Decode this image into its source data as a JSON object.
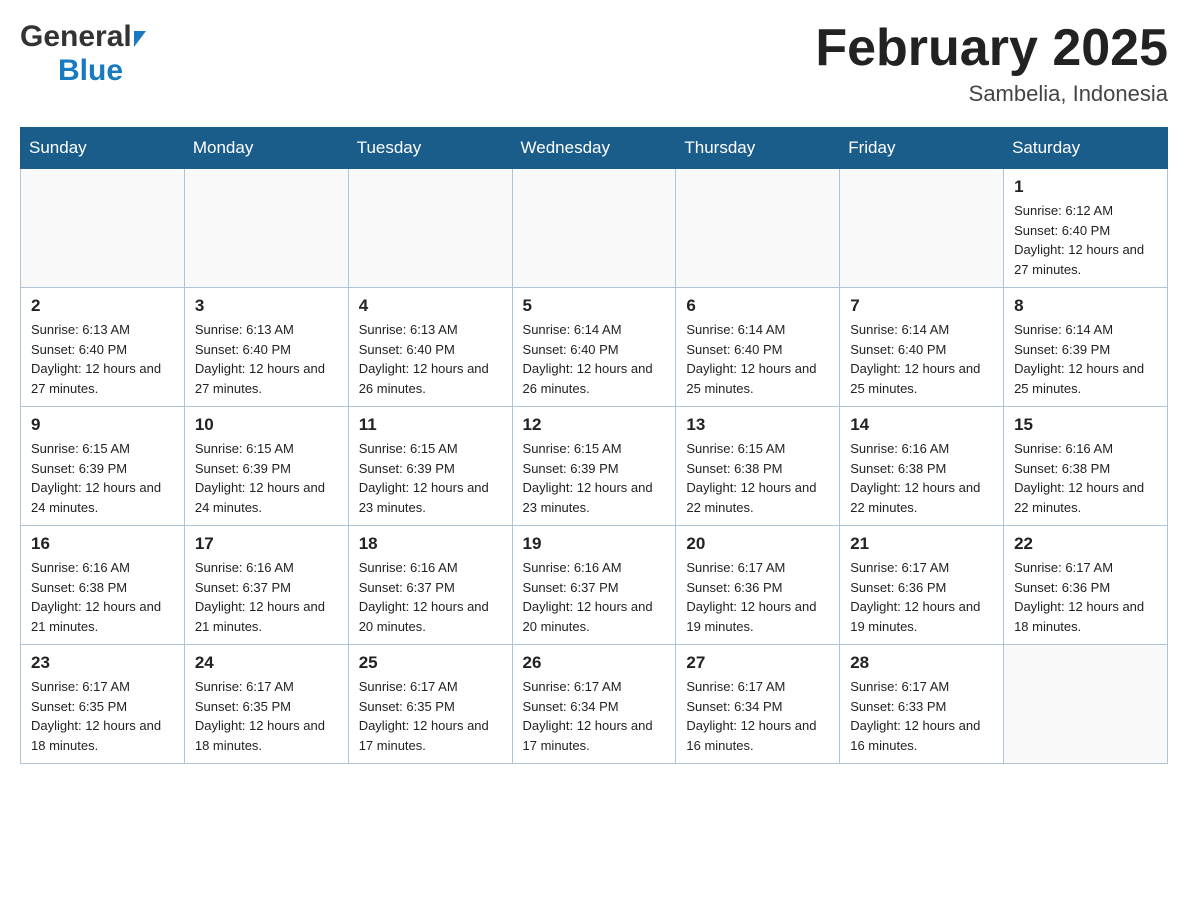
{
  "header": {
    "logo_general": "General",
    "logo_blue": "Blue",
    "month_title": "February 2025",
    "location": "Sambelia, Indonesia"
  },
  "days_of_week": [
    "Sunday",
    "Monday",
    "Tuesday",
    "Wednesday",
    "Thursday",
    "Friday",
    "Saturday"
  ],
  "weeks": [
    {
      "days": [
        {
          "number": "",
          "sunrise": "",
          "sunset": "",
          "daylight": "",
          "empty": true
        },
        {
          "number": "",
          "sunrise": "",
          "sunset": "",
          "daylight": "",
          "empty": true
        },
        {
          "number": "",
          "sunrise": "",
          "sunset": "",
          "daylight": "",
          "empty": true
        },
        {
          "number": "",
          "sunrise": "",
          "sunset": "",
          "daylight": "",
          "empty": true
        },
        {
          "number": "",
          "sunrise": "",
          "sunset": "",
          "daylight": "",
          "empty": true
        },
        {
          "number": "",
          "sunrise": "",
          "sunset": "",
          "daylight": "",
          "empty": true
        },
        {
          "number": "1",
          "sunrise": "Sunrise: 6:12 AM",
          "sunset": "Sunset: 6:40 PM",
          "daylight": "Daylight: 12 hours and 27 minutes.",
          "empty": false
        }
      ]
    },
    {
      "days": [
        {
          "number": "2",
          "sunrise": "Sunrise: 6:13 AM",
          "sunset": "Sunset: 6:40 PM",
          "daylight": "Daylight: 12 hours and 27 minutes.",
          "empty": false
        },
        {
          "number": "3",
          "sunrise": "Sunrise: 6:13 AM",
          "sunset": "Sunset: 6:40 PM",
          "daylight": "Daylight: 12 hours and 27 minutes.",
          "empty": false
        },
        {
          "number": "4",
          "sunrise": "Sunrise: 6:13 AM",
          "sunset": "Sunset: 6:40 PM",
          "daylight": "Daylight: 12 hours and 26 minutes.",
          "empty": false
        },
        {
          "number": "5",
          "sunrise": "Sunrise: 6:14 AM",
          "sunset": "Sunset: 6:40 PM",
          "daylight": "Daylight: 12 hours and 26 minutes.",
          "empty": false
        },
        {
          "number": "6",
          "sunrise": "Sunrise: 6:14 AM",
          "sunset": "Sunset: 6:40 PM",
          "daylight": "Daylight: 12 hours and 25 minutes.",
          "empty": false
        },
        {
          "number": "7",
          "sunrise": "Sunrise: 6:14 AM",
          "sunset": "Sunset: 6:40 PM",
          "daylight": "Daylight: 12 hours and 25 minutes.",
          "empty": false
        },
        {
          "number": "8",
          "sunrise": "Sunrise: 6:14 AM",
          "sunset": "Sunset: 6:39 PM",
          "daylight": "Daylight: 12 hours and 25 minutes.",
          "empty": false
        }
      ]
    },
    {
      "days": [
        {
          "number": "9",
          "sunrise": "Sunrise: 6:15 AM",
          "sunset": "Sunset: 6:39 PM",
          "daylight": "Daylight: 12 hours and 24 minutes.",
          "empty": false
        },
        {
          "number": "10",
          "sunrise": "Sunrise: 6:15 AM",
          "sunset": "Sunset: 6:39 PM",
          "daylight": "Daylight: 12 hours and 24 minutes.",
          "empty": false
        },
        {
          "number": "11",
          "sunrise": "Sunrise: 6:15 AM",
          "sunset": "Sunset: 6:39 PM",
          "daylight": "Daylight: 12 hours and 23 minutes.",
          "empty": false
        },
        {
          "number": "12",
          "sunrise": "Sunrise: 6:15 AM",
          "sunset": "Sunset: 6:39 PM",
          "daylight": "Daylight: 12 hours and 23 minutes.",
          "empty": false
        },
        {
          "number": "13",
          "sunrise": "Sunrise: 6:15 AM",
          "sunset": "Sunset: 6:38 PM",
          "daylight": "Daylight: 12 hours and 22 minutes.",
          "empty": false
        },
        {
          "number": "14",
          "sunrise": "Sunrise: 6:16 AM",
          "sunset": "Sunset: 6:38 PM",
          "daylight": "Daylight: 12 hours and 22 minutes.",
          "empty": false
        },
        {
          "number": "15",
          "sunrise": "Sunrise: 6:16 AM",
          "sunset": "Sunset: 6:38 PM",
          "daylight": "Daylight: 12 hours and 22 minutes.",
          "empty": false
        }
      ]
    },
    {
      "days": [
        {
          "number": "16",
          "sunrise": "Sunrise: 6:16 AM",
          "sunset": "Sunset: 6:38 PM",
          "daylight": "Daylight: 12 hours and 21 minutes.",
          "empty": false
        },
        {
          "number": "17",
          "sunrise": "Sunrise: 6:16 AM",
          "sunset": "Sunset: 6:37 PM",
          "daylight": "Daylight: 12 hours and 21 minutes.",
          "empty": false
        },
        {
          "number": "18",
          "sunrise": "Sunrise: 6:16 AM",
          "sunset": "Sunset: 6:37 PM",
          "daylight": "Daylight: 12 hours and 20 minutes.",
          "empty": false
        },
        {
          "number": "19",
          "sunrise": "Sunrise: 6:16 AM",
          "sunset": "Sunset: 6:37 PM",
          "daylight": "Daylight: 12 hours and 20 minutes.",
          "empty": false
        },
        {
          "number": "20",
          "sunrise": "Sunrise: 6:17 AM",
          "sunset": "Sunset: 6:36 PM",
          "daylight": "Daylight: 12 hours and 19 minutes.",
          "empty": false
        },
        {
          "number": "21",
          "sunrise": "Sunrise: 6:17 AM",
          "sunset": "Sunset: 6:36 PM",
          "daylight": "Daylight: 12 hours and 19 minutes.",
          "empty": false
        },
        {
          "number": "22",
          "sunrise": "Sunrise: 6:17 AM",
          "sunset": "Sunset: 6:36 PM",
          "daylight": "Daylight: 12 hours and 18 minutes.",
          "empty": false
        }
      ]
    },
    {
      "days": [
        {
          "number": "23",
          "sunrise": "Sunrise: 6:17 AM",
          "sunset": "Sunset: 6:35 PM",
          "daylight": "Daylight: 12 hours and 18 minutes.",
          "empty": false
        },
        {
          "number": "24",
          "sunrise": "Sunrise: 6:17 AM",
          "sunset": "Sunset: 6:35 PM",
          "daylight": "Daylight: 12 hours and 18 minutes.",
          "empty": false
        },
        {
          "number": "25",
          "sunrise": "Sunrise: 6:17 AM",
          "sunset": "Sunset: 6:35 PM",
          "daylight": "Daylight: 12 hours and 17 minutes.",
          "empty": false
        },
        {
          "number": "26",
          "sunrise": "Sunrise: 6:17 AM",
          "sunset": "Sunset: 6:34 PM",
          "daylight": "Daylight: 12 hours and 17 minutes.",
          "empty": false
        },
        {
          "number": "27",
          "sunrise": "Sunrise: 6:17 AM",
          "sunset": "Sunset: 6:34 PM",
          "daylight": "Daylight: 12 hours and 16 minutes.",
          "empty": false
        },
        {
          "number": "28",
          "sunrise": "Sunrise: 6:17 AM",
          "sunset": "Sunset: 6:33 PM",
          "daylight": "Daylight: 12 hours and 16 minutes.",
          "empty": false
        },
        {
          "number": "",
          "sunrise": "",
          "sunset": "",
          "daylight": "",
          "empty": true
        }
      ]
    }
  ]
}
